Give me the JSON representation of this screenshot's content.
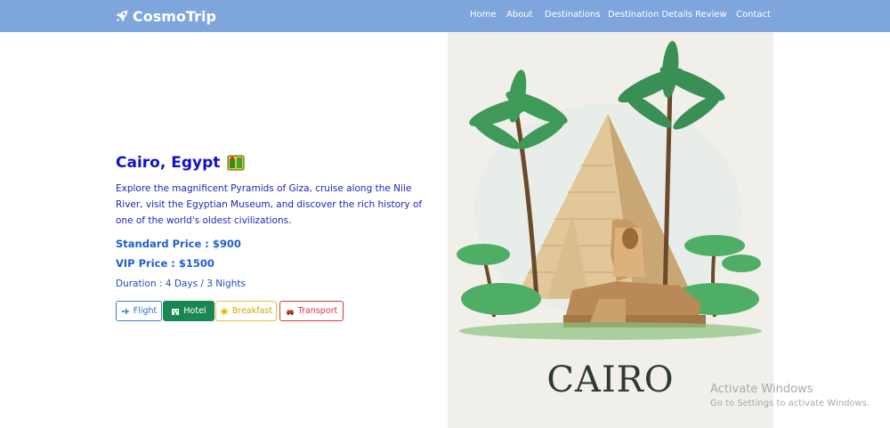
{
  "navbar": {
    "brand": "CosmoTrip",
    "brand_icon": "rocket-icon",
    "links": [
      "Home",
      "About",
      "Destinations",
      "Destination Details",
      "Review",
      "Contact"
    ],
    "color": "#7fa6dc"
  },
  "destination": {
    "title": "Cairo, Egypt",
    "flag_icon": "egypt-flag-icon",
    "description": "Explore the magnificent Pyramids of Giza, cruise along the Nile River, visit the Egyptian Museum, and discover the rich history of one of the world's oldest civilizations.",
    "standard_price": "Standard Price : $900",
    "vip_price": "VIP Price : $1500",
    "duration": "Duration : 4 Days / 3 Nights",
    "amenities": [
      {
        "label": "Flight",
        "icon": "airplane-icon",
        "color": "#3b7dd8"
      },
      {
        "label": "Hotel",
        "icon": "hotel-icon",
        "color": "#198754"
      },
      {
        "label": "Breakfast",
        "icon": "breakfast-icon",
        "color": "#e8c040"
      },
      {
        "label": "Transport",
        "icon": "car-icon",
        "color": "#dc3545"
      }
    ]
  },
  "poster": {
    "title": "CAIRO"
  },
  "watermark": {
    "title": "Activate Windows",
    "subtitle": "Go to Settings to activate Windows."
  }
}
